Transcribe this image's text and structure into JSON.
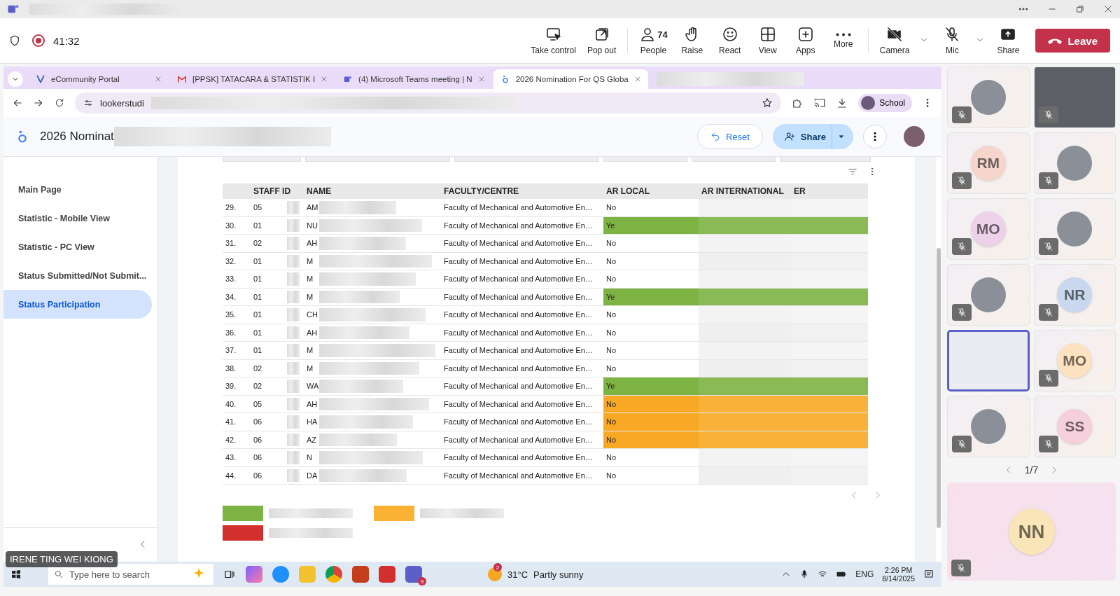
{
  "meeting": {
    "timer": "41:32",
    "recording": true
  },
  "toolbar": [
    {
      "label": "Take control",
      "kind": "take-control"
    },
    {
      "label": "Pop out",
      "kind": "pop-out"
    },
    {
      "label": "People",
      "kind": "people",
      "count": "74"
    },
    {
      "label": "Raise",
      "kind": "raise"
    },
    {
      "label": "React",
      "kind": "react"
    },
    {
      "label": "View",
      "kind": "view"
    },
    {
      "label": "Apps",
      "kind": "apps"
    },
    {
      "label": "More",
      "kind": "more"
    },
    {
      "label": "Camera",
      "kind": "camera"
    },
    {
      "label": "Mic",
      "kind": "mic"
    },
    {
      "label": "Share",
      "kind": "share"
    }
  ],
  "leave_button": "Leave",
  "browser": {
    "tabs": [
      {
        "title": "eCommunity Portal",
        "kind": "portal",
        "selected": false
      },
      {
        "title": "[PPSK] TATACARA & STATISTIK I",
        "kind": "mail",
        "selected": false
      },
      {
        "title": "(4) Microsoft Teams meeting | N",
        "kind": "teams",
        "selected": false
      },
      {
        "title": "2026 Nomination For QS Globa",
        "kind": "looker",
        "selected": true
      }
    ],
    "url": "lookerstudi",
    "profile": "School"
  },
  "report": {
    "title": "2026 Nominat",
    "reset": "Reset",
    "share": "Share"
  },
  "sidebar": {
    "items": [
      {
        "label": "Main Page",
        "selected": false
      },
      {
        "label": "Statistic - Mobile View",
        "selected": false
      },
      {
        "label": "Statistic - PC View",
        "selected": false
      },
      {
        "label": "Status Submitted/Not Submit...",
        "selected": false
      },
      {
        "label": "Status Participation",
        "selected": true
      }
    ]
  },
  "table": {
    "columns": [
      "STAFF ID",
      "NAME",
      "FACULTY/CENTRE",
      "AR LOCAL",
      "AR INTERNATIONAL",
      "ER"
    ],
    "rows": [
      {
        "n": "29.",
        "staff_id": "05",
        "name": "AM",
        "faculty": "Faculty of Mechanical and Automotive En…",
        "ar_local": "No"
      },
      {
        "n": "30.",
        "staff_id": "01",
        "name": "NU",
        "faculty": "Faculty of Mechanical and Automotive En…",
        "ar_local": "Ye",
        "color": "#7cb342"
      },
      {
        "n": "31.",
        "staff_id": "02",
        "name": "AH",
        "faculty": "Faculty of Mechanical and Automotive En…",
        "ar_local": "No"
      },
      {
        "n": "32.",
        "staff_id": "01",
        "name": "M",
        "faculty": "Faculty of Mechanical and Automotive En…",
        "ar_local": "No"
      },
      {
        "n": "33.",
        "staff_id": "01",
        "name": "M",
        "faculty": "Faculty of Mechanical and Automotive En…",
        "ar_local": "No"
      },
      {
        "n": "34.",
        "staff_id": "01",
        "name": "M",
        "faculty": "Faculty of Mechanical and Automotive En…",
        "ar_local": "Ye",
        "color": "#7cb342"
      },
      {
        "n": "35.",
        "staff_id": "01",
        "name": "CH",
        "faculty": "Faculty of Mechanical and Automotive En…",
        "ar_local": "No"
      },
      {
        "n": "36.",
        "staff_id": "01",
        "name": "AH",
        "faculty": "Faculty of Mechanical and Automotive En…",
        "ar_local": "No"
      },
      {
        "n": "37.",
        "staff_id": "01",
        "name": "M",
        "faculty": "Faculty of Mechanical and Automotive En…",
        "ar_local": "No"
      },
      {
        "n": "38.",
        "staff_id": "02",
        "name": "M",
        "faculty": "Faculty of Mechanical and Automotive En…",
        "ar_local": "No"
      },
      {
        "n": "39.",
        "staff_id": "02",
        "name": "WA",
        "faculty": "Faculty of Mechanical and Automotive En…",
        "ar_local": "Ye",
        "color": "#7cb342"
      },
      {
        "n": "40.",
        "staff_id": "05",
        "name": "AH",
        "faculty": "Faculty of Mechanical and Automotive En…",
        "ar_local": "No",
        "color": "#f9a825"
      },
      {
        "n": "41.",
        "staff_id": "06",
        "name": "HA",
        "faculty": "Faculty of Mechanical and Automotive En…",
        "ar_local": "No",
        "color": "#f9a825"
      },
      {
        "n": "42.",
        "staff_id": "06",
        "name": "AZ",
        "faculty": "Faculty of Mechanical and Automotive En…",
        "ar_local": "No",
        "color": "#f9a825"
      },
      {
        "n": "43.",
        "staff_id": "06",
        "name": "N",
        "faculty": "Faculty of Mechanical and Automotive En…",
        "ar_local": "No"
      },
      {
        "n": "44.",
        "staff_id": "06",
        "name": "DA",
        "faculty": "Faculty of Mechanical and Automotive En…",
        "ar_local": "No"
      }
    ]
  },
  "legend": [
    {
      "color": "#7cb342"
    },
    {
      "color": "#f9b233"
    },
    {
      "color": "#d32f2f"
    }
  ],
  "taskbar": {
    "search_placeholder": "Type here to search",
    "teams_badge": "9",
    "weather_badge": "2",
    "temperature": "31°C",
    "weather": "Partly sunny",
    "language": "ENG",
    "time": "2:26 PM",
    "date": "8/14/2025"
  },
  "presenter_name": "IRENE TING WEI KIONG",
  "participants": {
    "tiles": [
      {
        "kind": "photo",
        "muted": true,
        "selected": false
      },
      {
        "kind": "video",
        "muted": true,
        "selected": false
      },
      {
        "kind": "initials",
        "initials": "RM",
        "color": "#f6d6cc",
        "muted": true,
        "selected": false
      },
      {
        "kind": "photo",
        "muted": true,
        "selected": false
      },
      {
        "kind": "initials",
        "initials": "MO",
        "color": "#ecd1e8",
        "muted": true,
        "selected": false
      },
      {
        "kind": "photo",
        "muted": true,
        "selected": false
      },
      {
        "kind": "photo",
        "muted": true,
        "selected": false
      },
      {
        "kind": "initials",
        "initials": "NR",
        "color": "#c9d8ee",
        "muted": true,
        "selected": false
      },
      {
        "kind": "video",
        "muted": false,
        "selected": true
      },
      {
        "kind": "initials",
        "initials": "MO",
        "color": "#fde2c2",
        "muted": true,
        "selected": false
      },
      {
        "kind": "photo",
        "muted": true,
        "selected": false
      },
      {
        "kind": "initials",
        "initials": "SS",
        "color": "#f5cfdc",
        "muted": true,
        "selected": false
      }
    ],
    "pager": "1/7",
    "pinned": {
      "initials": "NN",
      "color": "#f9e5b8",
      "muted": true
    }
  }
}
